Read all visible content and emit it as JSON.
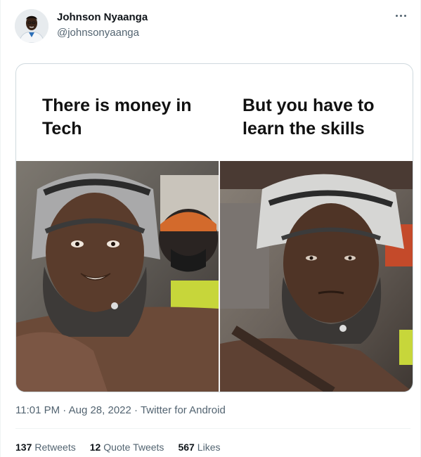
{
  "author": {
    "name": "Johnson Nyaanga",
    "handle": "@johnsonyaanga"
  },
  "more_icon": "ellipsis-icon",
  "meme": {
    "left_caption": "There is money in Tech",
    "right_caption": "But you have to learn the skills"
  },
  "meta": {
    "time": "11:01 PM",
    "dot": "·",
    "date": "Aug 28, 2022",
    "source": "Twitter for Android"
  },
  "stats": {
    "retweets_count": "137",
    "retweets_label": "Retweets",
    "quotes_count": "12",
    "quotes_label": "Quote Tweets",
    "likes_count": "567",
    "likes_label": "Likes"
  }
}
